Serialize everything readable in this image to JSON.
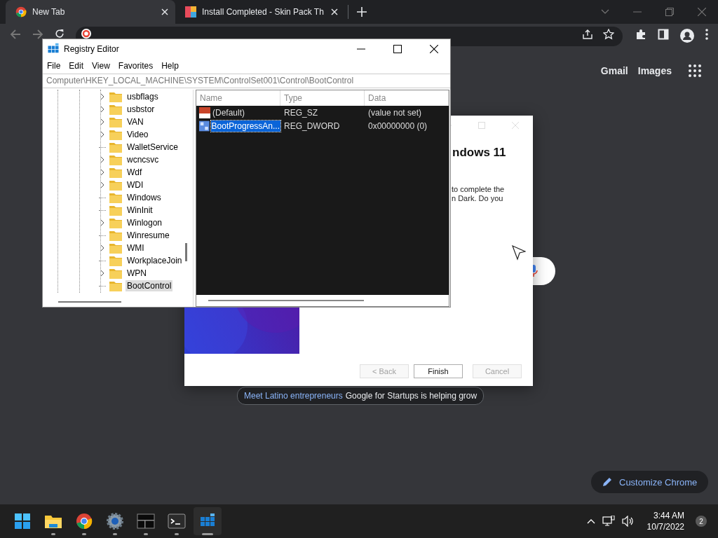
{
  "browser": {
    "tabs": [
      {
        "title": "New Tab",
        "selected": true
      },
      {
        "title": "Install Completed - Skin Pack Th",
        "selected": false
      }
    ],
    "header_links": [
      "Gmail",
      "Images"
    ],
    "promo": {
      "link": "Meet Latino entrepreneurs",
      "text": "Google for Startups is helping grow"
    },
    "customize_button": "Customize Chrome"
  },
  "installer": {
    "heading": "ndows 11",
    "body_lines": [
      "to complete the",
      "n Dark. Do you"
    ],
    "buttons": [
      {
        "label": "< Back",
        "disabled": true
      },
      {
        "label": "Finish",
        "disabled": false
      },
      {
        "label": "Cancel",
        "disabled": true
      }
    ]
  },
  "registry_editor": {
    "title": "Registry Editor",
    "menu": [
      "File",
      "Edit",
      "View",
      "Favorites",
      "Help"
    ],
    "address": "Computer\\HKEY_LOCAL_MACHINE\\SYSTEM\\ControlSet001\\Control\\BootControl",
    "tree": [
      {
        "label": "usbflags",
        "expandable": true,
        "selected": false
      },
      {
        "label": "usbstor",
        "expandable": true,
        "selected": false
      },
      {
        "label": "VAN",
        "expandable": true,
        "selected": false
      },
      {
        "label": "Video",
        "expandable": true,
        "selected": false
      },
      {
        "label": "WalletService",
        "expandable": false,
        "selected": false
      },
      {
        "label": "wcncsvc",
        "expandable": true,
        "selected": false
      },
      {
        "label": "Wdf",
        "expandable": true,
        "selected": false
      },
      {
        "label": "WDI",
        "expandable": true,
        "selected": false
      },
      {
        "label": "Windows",
        "expandable": false,
        "selected": false
      },
      {
        "label": "WinInit",
        "expandable": false,
        "selected": false
      },
      {
        "label": "Winlogon",
        "expandable": true,
        "selected": false
      },
      {
        "label": "Winresume",
        "expandable": false,
        "selected": false
      },
      {
        "label": "WMI",
        "expandable": true,
        "selected": false
      },
      {
        "label": "WorkplaceJoin",
        "expandable": false,
        "selected": false
      },
      {
        "label": "WPN",
        "expandable": true,
        "selected": false
      },
      {
        "label": "BootControl",
        "expandable": false,
        "selected": true
      }
    ],
    "columns": [
      "Name",
      "Type",
      "Data"
    ],
    "values": [
      {
        "name": "(Default)",
        "type": "REG_SZ",
        "data": "(value not set)",
        "kind": "string",
        "selected": false
      },
      {
        "name": "BootProgressAn...",
        "type": "REG_DWORD",
        "data": "0x00000000 (0)",
        "kind": "binary",
        "selected": true
      }
    ]
  },
  "taskbar": {
    "apps": [
      {
        "kind": "start",
        "running": false,
        "selected": false
      },
      {
        "kind": "explorer",
        "running": true,
        "selected": false
      },
      {
        "kind": "chrome",
        "running": true,
        "selected": false
      },
      {
        "kind": "settings",
        "running": true,
        "selected": false
      },
      {
        "kind": "window",
        "running": true,
        "selected": false
      },
      {
        "kind": "terminal",
        "running": true,
        "selected": false
      },
      {
        "kind": "regedit",
        "running": true,
        "selected": true
      }
    ],
    "time": "3:44 AM",
    "date": "10/7/2022",
    "notifications": "2"
  }
}
